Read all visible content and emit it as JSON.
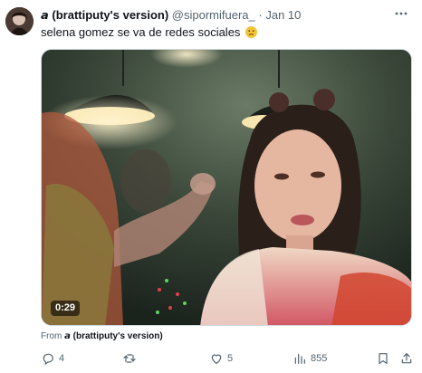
{
  "tweet": {
    "author_name": "𝙖 (brattiputy's version)",
    "handle": "@sipormifuera_",
    "separator": "·",
    "date": "Jan 10",
    "text_part1": "selena gomez ",
    "text_part2": "se va de",
    "text_part3": " redes sociales",
    "video_duration": "0:29",
    "from_label": "From",
    "from_name": "𝙖 (brattiputy's version)"
  },
  "actions": {
    "reply": {
      "icon": "reply-icon",
      "count": "4"
    },
    "retweet": {
      "icon": "retweet-icon",
      "count": ""
    },
    "like": {
      "icon": "heart-icon",
      "count": "5"
    },
    "views": {
      "icon": "views-icon",
      "count": "855"
    },
    "bookmark": {
      "icon": "bookmark-icon"
    },
    "share": {
      "icon": "share-icon"
    }
  },
  "colors": {
    "text": "#0f1419",
    "secondary": "#536471",
    "border": "#cfd9de"
  }
}
